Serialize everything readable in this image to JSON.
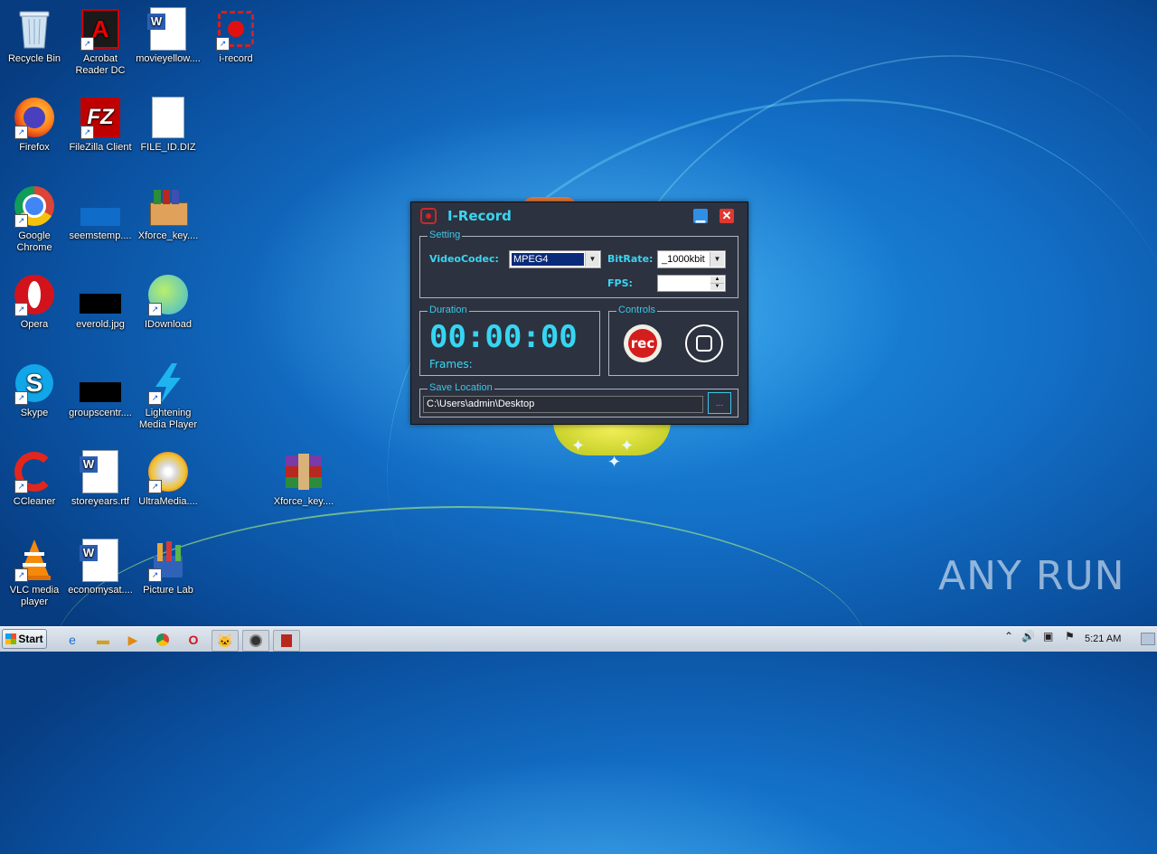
{
  "desktop_icons": [
    {
      "label": "Recycle Bin",
      "icon": "recycle-bin-icon"
    },
    {
      "label": "Acrobat Reader DC",
      "icon": "acrobat-icon"
    },
    {
      "label": "movieyellow....",
      "icon": "word-doc-icon"
    },
    {
      "label": "i-record",
      "icon": "i-record-icon"
    },
    {
      "label": "Firefox",
      "icon": "firefox-icon"
    },
    {
      "label": "FileZilla Client",
      "icon": "filezilla-icon"
    },
    {
      "label": "FILE_ID.DIZ",
      "icon": "file-icon"
    },
    {
      "label": "Google Chrome",
      "icon": "chrome-icon"
    },
    {
      "label": "seemstemp....",
      "icon": "image-file-icon"
    },
    {
      "label": "Xforce_key....",
      "icon": "winrar-archive-icon"
    },
    {
      "label": "Opera",
      "icon": "opera-icon"
    },
    {
      "label": "everold.jpg",
      "icon": "image-file-icon"
    },
    {
      "label": "IDownload",
      "icon": "idownload-icon"
    },
    {
      "label": "Skype",
      "icon": "skype-icon"
    },
    {
      "label": "groupscentr....",
      "icon": "image-file-icon"
    },
    {
      "label": "Lightening Media Player",
      "icon": "lightning-icon"
    },
    {
      "label": "CCleaner",
      "icon": "ccleaner-icon"
    },
    {
      "label": "storeyears.rtf",
      "icon": "word-doc-icon"
    },
    {
      "label": "UltraMedia....",
      "icon": "ultramedia-icon"
    },
    {
      "label": "Xforce_key....",
      "icon": "winrar-icon"
    },
    {
      "label": "VLC media player",
      "icon": "vlc-icon"
    },
    {
      "label": "economysat....",
      "icon": "word-doc-icon"
    },
    {
      "label": "Picture Lab",
      "icon": "picture-lab-icon"
    }
  ],
  "window": {
    "title": "I-Record",
    "setting_legend": "Setting",
    "videocodec_label": "VideoCodec:",
    "videocodec_value": "MPEG4",
    "bitrate_label": "BitRate:",
    "bitrate_value": "_1000kbit",
    "fps_label": "FPS:",
    "fps_value": "",
    "duration_legend": "Duration",
    "duration_value": "00:00:00",
    "frames_label": "Frames:",
    "controls_legend": "Controls",
    "rec_label": "rec",
    "save_legend": "Save Location",
    "save_path": "C:\\Users\\admin\\Desktop",
    "browse_label": "..."
  },
  "taskbar": {
    "start_label": "Start",
    "apps": [
      "ie-icon",
      "explorer-icon",
      "media-player-icon",
      "chrome-icon",
      "opera-icon",
      "cat-app-icon",
      "i-record-taskbar-icon",
      "winrar-taskbar-icon"
    ],
    "clock": "5:21 AM"
  },
  "watermark": "ANY RUN",
  "colors": {
    "accent": "#39d6f2",
    "window_bg": "#2d3240",
    "rec_red": "#d41e1e"
  }
}
